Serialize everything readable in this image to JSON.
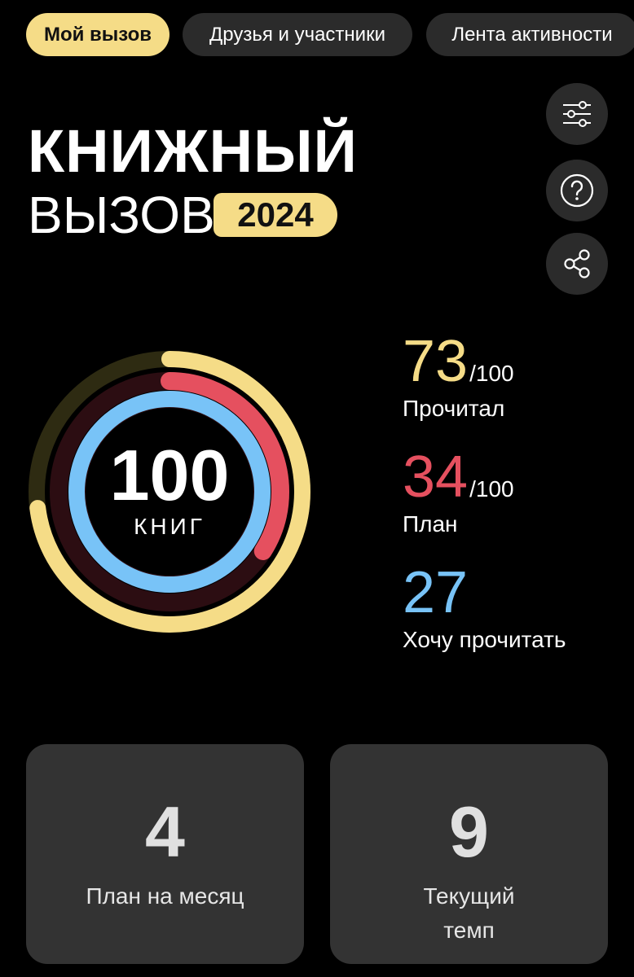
{
  "tabs": [
    {
      "label": "Мой вызов",
      "active": true
    },
    {
      "label": "Друзья и участники",
      "active": false
    },
    {
      "label": "Лента активности",
      "active": false
    }
  ],
  "header": {
    "title_line1": "КНИЖНЫЙ",
    "title_line2": "ВЫЗОВ",
    "year": "2024"
  },
  "actions": [
    {
      "name": "filter-settings",
      "icon": "sliders-icon"
    },
    {
      "name": "help",
      "icon": "question-icon"
    },
    {
      "name": "share",
      "icon": "share-icon"
    }
  ],
  "goal": {
    "number": "100",
    "unit": "КНИГ"
  },
  "rings": {
    "read_fraction": 0.73,
    "plan_fraction": 0.34,
    "want_fraction": 1.0
  },
  "stats": {
    "read": {
      "value": "73",
      "of": "/100",
      "label": "Прочитал"
    },
    "plan": {
      "value": "34",
      "of": "/100",
      "label": "План"
    },
    "want": {
      "value": "27",
      "label": "Хочу прочитать"
    }
  },
  "cards": {
    "month_plan": {
      "value": "4",
      "label": "План на месяц"
    },
    "pace": {
      "value": "9",
      "label_line1": "Текущий",
      "label_line2": "темп"
    }
  },
  "colors": {
    "yellow": "#f5dc87",
    "red": "#e5505f",
    "blue": "#78c3f7",
    "card_bg": "#333333"
  }
}
